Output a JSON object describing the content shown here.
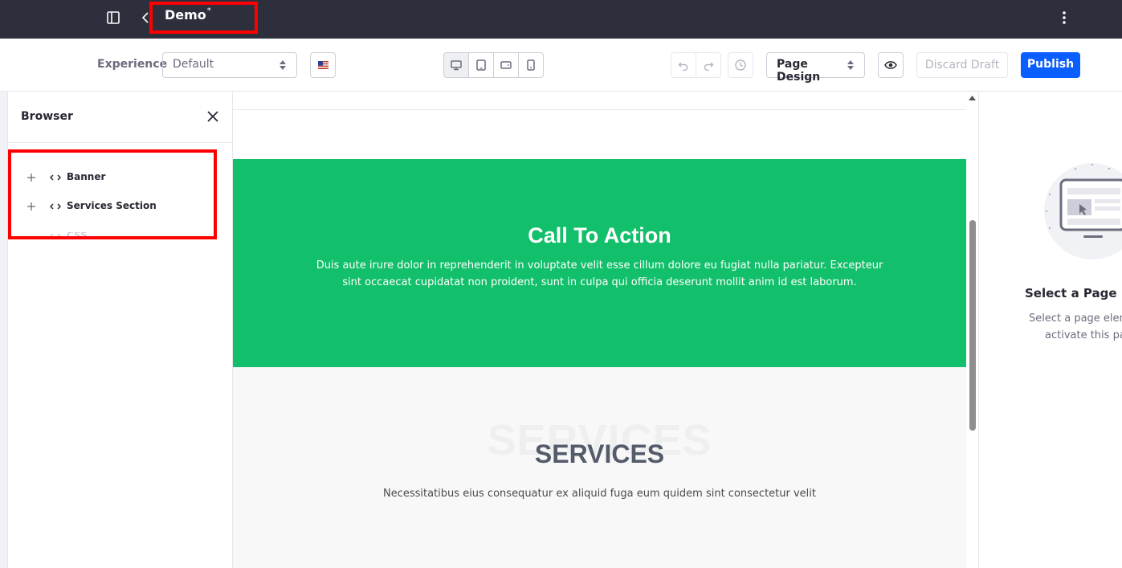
{
  "topbar": {
    "title": "Demo",
    "unsaved_marker": "*"
  },
  "toolbar": {
    "experience_label": "Experience",
    "experience_value": "Default",
    "language_flag": "en-US",
    "devices": [
      "desktop-icon",
      "tablet-icon",
      "landscape-phone-icon",
      "portrait-phone-icon"
    ],
    "active_device": "desktop",
    "page_design_label": "Page Design",
    "discard_label": "Discard Draft",
    "publish_label": "Publish"
  },
  "browser_panel": {
    "title": "Browser",
    "items": [
      {
        "label": "Banner"
      },
      {
        "label": "Services Section"
      },
      {
        "label": "CSS"
      }
    ]
  },
  "canvas": {
    "cta": {
      "title": "Call To Action",
      "text": "Duis aute irure dolor in reprehenderit in voluptate velit esse cillum dolore eu fugiat nulla pariatur. Excepteur sint occaecat cupidatat non proident, sunt in culpa qui officia deserunt mollit anim id est laborum."
    },
    "services": {
      "ghost_title": "SERVICES",
      "title": "SERVICES",
      "text": "Necessitatibus eius consequatur ex aliquid fuga eum quidem sint consectetur velit"
    }
  },
  "right_panel": {
    "title": "Select a Page Ele",
    "text_line1": "Select a page elem",
    "text_line2": "activate this par"
  },
  "colors": {
    "topbar_bg": "#2d2f3c",
    "primary": "#0b5fff",
    "cta_bg": "#12bf6a",
    "highlight": "#ff0000"
  }
}
